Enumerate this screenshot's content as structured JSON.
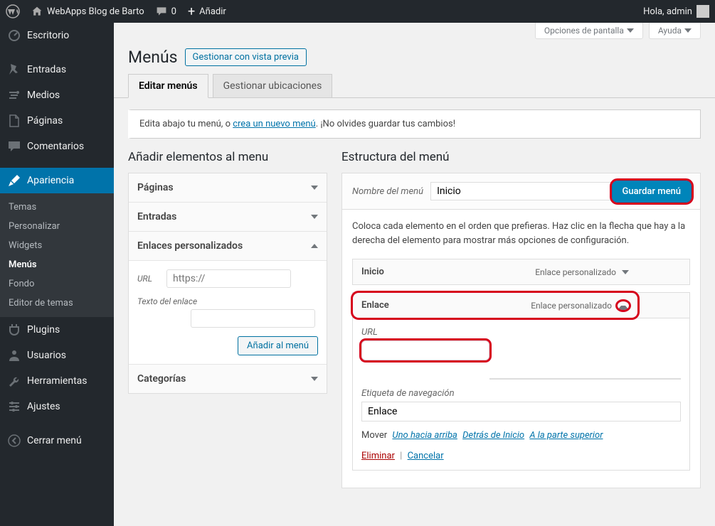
{
  "adminbar": {
    "site_name": "WebApps Blog de Barto",
    "comments_count": "0",
    "add_new": "Añadir",
    "greeting": "Hola, admin"
  },
  "sidebar": {
    "items": [
      {
        "label": "Escritorio"
      },
      {
        "label": "Entradas"
      },
      {
        "label": "Medios"
      },
      {
        "label": "Páginas"
      },
      {
        "label": "Comentarios"
      },
      {
        "label": "Apariencia"
      },
      {
        "label": "Plugins"
      },
      {
        "label": "Usuarios"
      },
      {
        "label": "Herramientas"
      },
      {
        "label": "Ajustes"
      },
      {
        "label": "Cerrar menú"
      }
    ],
    "appearance_sub": [
      {
        "label": "Temas"
      },
      {
        "label": "Personalizar"
      },
      {
        "label": "Widgets"
      },
      {
        "label": "Menús"
      },
      {
        "label": "Fondo"
      },
      {
        "label": "Editor de temas"
      }
    ]
  },
  "screen_meta": {
    "screen_options": "Opciones de pantalla",
    "help": "Ayuda"
  },
  "heading": "Menús",
  "page_action": "Gestionar con vista previa",
  "tabs": {
    "edit": "Editar menús",
    "locations": "Gestionar ubicaciones"
  },
  "notice": {
    "pre": "Edita abajo tu menú, o ",
    "link": "crea un nuevo menú",
    "post": ". ¡No olvides guardar tus cambios!"
  },
  "add_title": "Añadir elementos al menu",
  "structure_title": "Estructura del menú",
  "accordion": {
    "pages": "Páginas",
    "posts": "Entradas",
    "custom": "Enlaces personalizados",
    "categories": "Categorías"
  },
  "custom_link": {
    "url_label": "URL",
    "url_placeholder": "https://",
    "text_label": "Texto del enlace",
    "add_button": "Añadir al menú"
  },
  "menu": {
    "name_label": "Nombre del menú",
    "name_value": "Inicio",
    "save_button": "Guardar menú",
    "instructions": "Coloca cada elemento en el orden que prefieras. Haz clic en la flecha que hay a la derecha del elemento para mostrar más opciones de configuración."
  },
  "menu_items": [
    {
      "title": "Inicio",
      "type": "Enlace personalizado"
    },
    {
      "title": "Enlace",
      "type": "Enlace personalizado"
    }
  ],
  "item_settings": {
    "url_label": "URL",
    "url_value": "",
    "nav_label": "Etiqueta de navegación",
    "nav_value": "Enlace",
    "move_label": "Mover",
    "move_up": "Uno hacia arriba",
    "move_under": "Detrás de Inicio",
    "move_top": "A la parte superior",
    "delete": "Eliminar",
    "cancel": "Cancelar"
  }
}
